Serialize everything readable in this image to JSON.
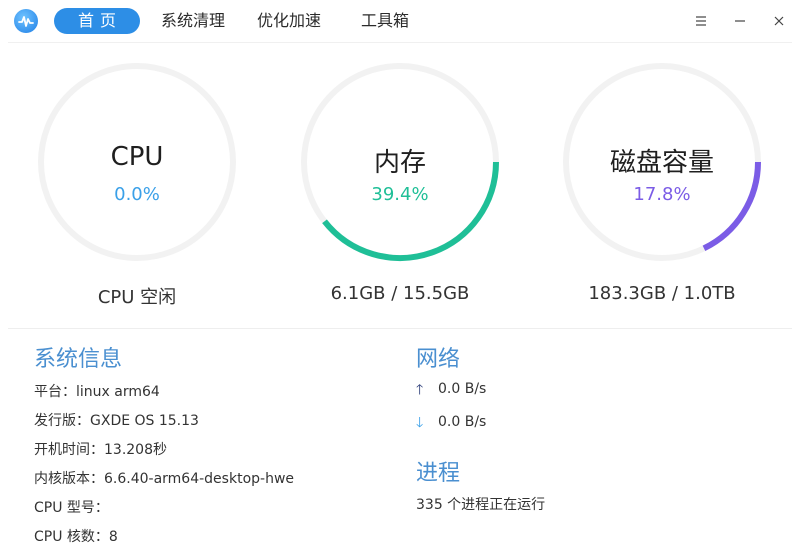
{
  "tabs": [
    {
      "label": "首页",
      "active": true
    },
    {
      "label": "系统清理",
      "active": false
    },
    {
      "label": "优化加速",
      "active": false
    },
    {
      "label": "工具箱",
      "active": false
    }
  ],
  "window_controls": [
    "menu-icon",
    "minimize-icon",
    "close-icon"
  ],
  "gauges": {
    "cpu": {
      "title": "CPU",
      "value": "0.0%",
      "caption": "CPU 空闲",
      "fraction": 0.0,
      "color": "#3aa0e8"
    },
    "memory": {
      "title": "内存",
      "value": "39.4%",
      "caption": "6.1GB / 15.5GB",
      "fraction": 0.394,
      "color": "#1fbf97"
    },
    "disk": {
      "title": "磁盘容量",
      "value": "17.8%",
      "caption": "183.3GB / 1.0TB",
      "fraction": 0.178,
      "color": "#7b5ce6"
    }
  },
  "system_info": {
    "title": "系统信息",
    "platform": "平台：linux arm64",
    "release": "发行版：GXDE OS 15.13",
    "uptime": "开机时间：13.208秒",
    "kernel": "内核版本：6.6.40-arm64-desktop-hwe",
    "cpu_model": "CPU 型号：",
    "cpu_cores": "CPU 核数：8"
  },
  "network": {
    "title": "网络",
    "upload": "0.0 B/s",
    "download": "0.0 B/s"
  },
  "process": {
    "title": "进程",
    "text": "335 个进程正在运行"
  },
  "colors": {
    "accent": "#2d8ee6",
    "section_title": "#4a8fd0",
    "ring_track": "#f2f2f2"
  }
}
